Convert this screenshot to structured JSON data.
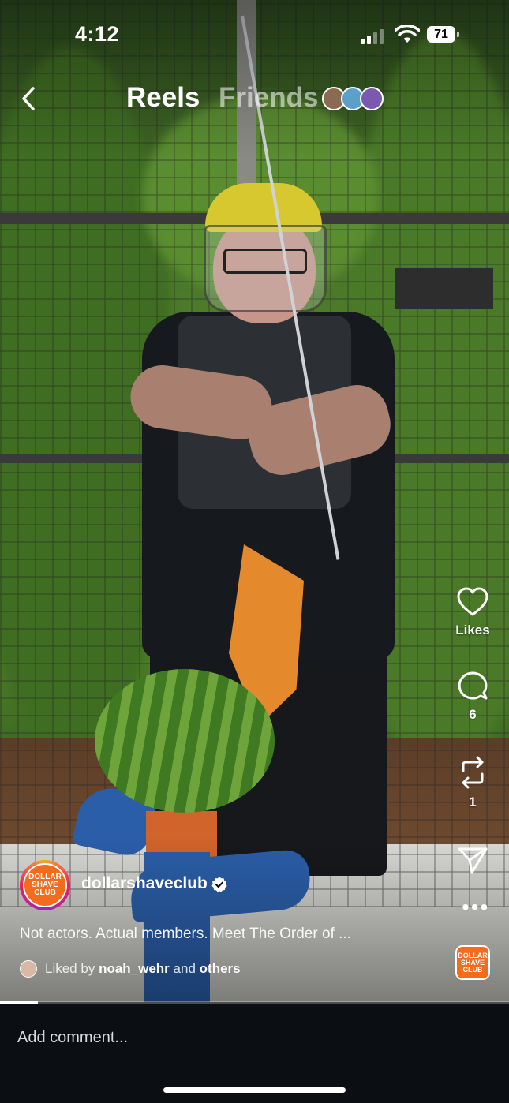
{
  "status_bar": {
    "time": "4:12",
    "battery": "71"
  },
  "header": {
    "tabs": [
      {
        "label": "Reels",
        "active": true
      },
      {
        "label": "Friends",
        "active": false
      }
    ]
  },
  "actions": {
    "likes_label": "Likes",
    "comments_count": "6",
    "reposts_count": "1"
  },
  "author": {
    "avatar_text": "DOLLAR SHAVE CLUB",
    "username": "dollarshaveclub",
    "verified": true
  },
  "caption": "Not actors. Actual members. Meet The Order of ...",
  "liked_by": {
    "prefix": "Liked by",
    "user": "noah_wehr",
    "conj": "and",
    "rest": "others"
  },
  "audio": {
    "thumb_text": "DOLLAR SHAVE CLUB"
  },
  "playback": {
    "progress": 0.075
  },
  "comment": {
    "placeholder": "Add comment..."
  },
  "colors": {
    "brand_orange": "#f36b1c",
    "comment_bar_bg": "#0b0f14"
  }
}
